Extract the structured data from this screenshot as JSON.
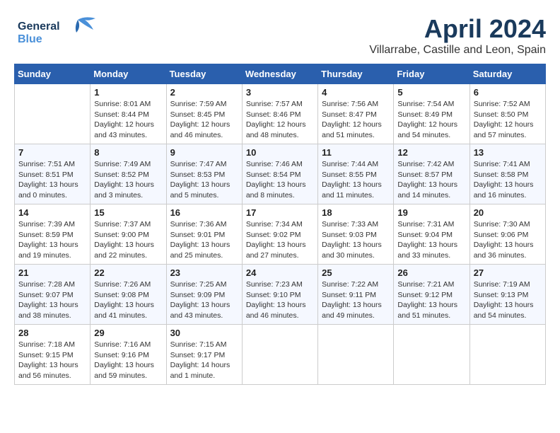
{
  "header": {
    "logo_line1": "General",
    "logo_line2": "Blue",
    "title": "April 2024",
    "subtitle": "Villarrabe, Castille and Leon, Spain"
  },
  "weekdays": [
    "Sunday",
    "Monday",
    "Tuesday",
    "Wednesday",
    "Thursday",
    "Friday",
    "Saturday"
  ],
  "weeks": [
    [
      {
        "day": "",
        "info": ""
      },
      {
        "day": "1",
        "info": "Sunrise: 8:01 AM\nSunset: 8:44 PM\nDaylight: 12 hours\nand 43 minutes."
      },
      {
        "day": "2",
        "info": "Sunrise: 7:59 AM\nSunset: 8:45 PM\nDaylight: 12 hours\nand 46 minutes."
      },
      {
        "day": "3",
        "info": "Sunrise: 7:57 AM\nSunset: 8:46 PM\nDaylight: 12 hours\nand 48 minutes."
      },
      {
        "day": "4",
        "info": "Sunrise: 7:56 AM\nSunset: 8:47 PM\nDaylight: 12 hours\nand 51 minutes."
      },
      {
        "day": "5",
        "info": "Sunrise: 7:54 AM\nSunset: 8:49 PM\nDaylight: 12 hours\nand 54 minutes."
      },
      {
        "day": "6",
        "info": "Sunrise: 7:52 AM\nSunset: 8:50 PM\nDaylight: 12 hours\nand 57 minutes."
      }
    ],
    [
      {
        "day": "7",
        "info": "Sunrise: 7:51 AM\nSunset: 8:51 PM\nDaylight: 13 hours\nand 0 minutes."
      },
      {
        "day": "8",
        "info": "Sunrise: 7:49 AM\nSunset: 8:52 PM\nDaylight: 13 hours\nand 3 minutes."
      },
      {
        "day": "9",
        "info": "Sunrise: 7:47 AM\nSunset: 8:53 PM\nDaylight: 13 hours\nand 5 minutes."
      },
      {
        "day": "10",
        "info": "Sunrise: 7:46 AM\nSunset: 8:54 PM\nDaylight: 13 hours\nand 8 minutes."
      },
      {
        "day": "11",
        "info": "Sunrise: 7:44 AM\nSunset: 8:55 PM\nDaylight: 13 hours\nand 11 minutes."
      },
      {
        "day": "12",
        "info": "Sunrise: 7:42 AM\nSunset: 8:57 PM\nDaylight: 13 hours\nand 14 minutes."
      },
      {
        "day": "13",
        "info": "Sunrise: 7:41 AM\nSunset: 8:58 PM\nDaylight: 13 hours\nand 16 minutes."
      }
    ],
    [
      {
        "day": "14",
        "info": "Sunrise: 7:39 AM\nSunset: 8:59 PM\nDaylight: 13 hours\nand 19 minutes."
      },
      {
        "day": "15",
        "info": "Sunrise: 7:37 AM\nSunset: 9:00 PM\nDaylight: 13 hours\nand 22 minutes."
      },
      {
        "day": "16",
        "info": "Sunrise: 7:36 AM\nSunset: 9:01 PM\nDaylight: 13 hours\nand 25 minutes."
      },
      {
        "day": "17",
        "info": "Sunrise: 7:34 AM\nSunset: 9:02 PM\nDaylight: 13 hours\nand 27 minutes."
      },
      {
        "day": "18",
        "info": "Sunrise: 7:33 AM\nSunset: 9:03 PM\nDaylight: 13 hours\nand 30 minutes."
      },
      {
        "day": "19",
        "info": "Sunrise: 7:31 AM\nSunset: 9:04 PM\nDaylight: 13 hours\nand 33 minutes."
      },
      {
        "day": "20",
        "info": "Sunrise: 7:30 AM\nSunset: 9:06 PM\nDaylight: 13 hours\nand 36 minutes."
      }
    ],
    [
      {
        "day": "21",
        "info": "Sunrise: 7:28 AM\nSunset: 9:07 PM\nDaylight: 13 hours\nand 38 minutes."
      },
      {
        "day": "22",
        "info": "Sunrise: 7:26 AM\nSunset: 9:08 PM\nDaylight: 13 hours\nand 41 minutes."
      },
      {
        "day": "23",
        "info": "Sunrise: 7:25 AM\nSunset: 9:09 PM\nDaylight: 13 hours\nand 43 minutes."
      },
      {
        "day": "24",
        "info": "Sunrise: 7:23 AM\nSunset: 9:10 PM\nDaylight: 13 hours\nand 46 minutes."
      },
      {
        "day": "25",
        "info": "Sunrise: 7:22 AM\nSunset: 9:11 PM\nDaylight: 13 hours\nand 49 minutes."
      },
      {
        "day": "26",
        "info": "Sunrise: 7:21 AM\nSunset: 9:12 PM\nDaylight: 13 hours\nand 51 minutes."
      },
      {
        "day": "27",
        "info": "Sunrise: 7:19 AM\nSunset: 9:13 PM\nDaylight: 13 hours\nand 54 minutes."
      }
    ],
    [
      {
        "day": "28",
        "info": "Sunrise: 7:18 AM\nSunset: 9:15 PM\nDaylight: 13 hours\nand 56 minutes."
      },
      {
        "day": "29",
        "info": "Sunrise: 7:16 AM\nSunset: 9:16 PM\nDaylight: 13 hours\nand 59 minutes."
      },
      {
        "day": "30",
        "info": "Sunrise: 7:15 AM\nSunset: 9:17 PM\nDaylight: 14 hours\nand 1 minute."
      },
      {
        "day": "",
        "info": ""
      },
      {
        "day": "",
        "info": ""
      },
      {
        "day": "",
        "info": ""
      },
      {
        "day": "",
        "info": ""
      }
    ]
  ]
}
